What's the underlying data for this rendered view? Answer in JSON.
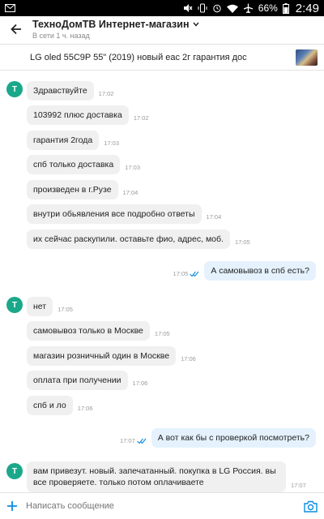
{
  "status_bar": {
    "battery": "66%",
    "time": "2:49"
  },
  "header": {
    "title": "ТехноДомТВ Интернет-магазин",
    "subtitle": "В сети 1 ч. назад"
  },
  "ad": {
    "title": "LG oled 55C9P 55\" (2019) новый eac 2г гарантия дос"
  },
  "avatar_letter": "T",
  "messages": [
    {
      "text": "Здравствуйте",
      "time": "17:02"
    },
    {
      "text": "103992 плюс доставка",
      "time": "17:02"
    },
    {
      "text": "гарантия 2года",
      "time": "17:03"
    },
    {
      "text": "спб только доставка",
      "time": "17:03"
    },
    {
      "text": "произведен в г.Рузе",
      "time": "17:04"
    },
    {
      "text": "внутри обьявления все подробно ответы",
      "time": "17:04"
    },
    {
      "text": "их сейчас раскупили. оставьте фио, адрес, моб.",
      "time": "17:05"
    },
    {
      "text": "А самовывоз в спб есть?",
      "time": "17:05"
    },
    {
      "text": "нет",
      "time": "17:05"
    },
    {
      "text": "самовывоз только в Москве",
      "time": "17:05"
    },
    {
      "text": "магазин розничный один в Москве",
      "time": "17:06"
    },
    {
      "text": "оплата при получении",
      "time": "17:06"
    },
    {
      "text": "спб и ло",
      "time": "17:06"
    },
    {
      "text": "А вот как бы с проверкой посмотреть?",
      "time": "17:07"
    },
    {
      "text": "вам привезут. новый. запечатанный. покупка в LG Россия. вы все проверяете. только потом оплачиваете",
      "time": "17:07"
    }
  ],
  "composer": {
    "placeholder": "Написать сообщение"
  },
  "colors": {
    "accent": "#0a8de0",
    "avatar": "#1aa88a",
    "incoming_bubble": "#f0f0f0",
    "outgoing_bubble": "#e5f2fd"
  },
  "icons": [
    "back-arrow-icon",
    "chevron-down-icon",
    "double-check-icon",
    "plus-icon",
    "camera-icon"
  ]
}
